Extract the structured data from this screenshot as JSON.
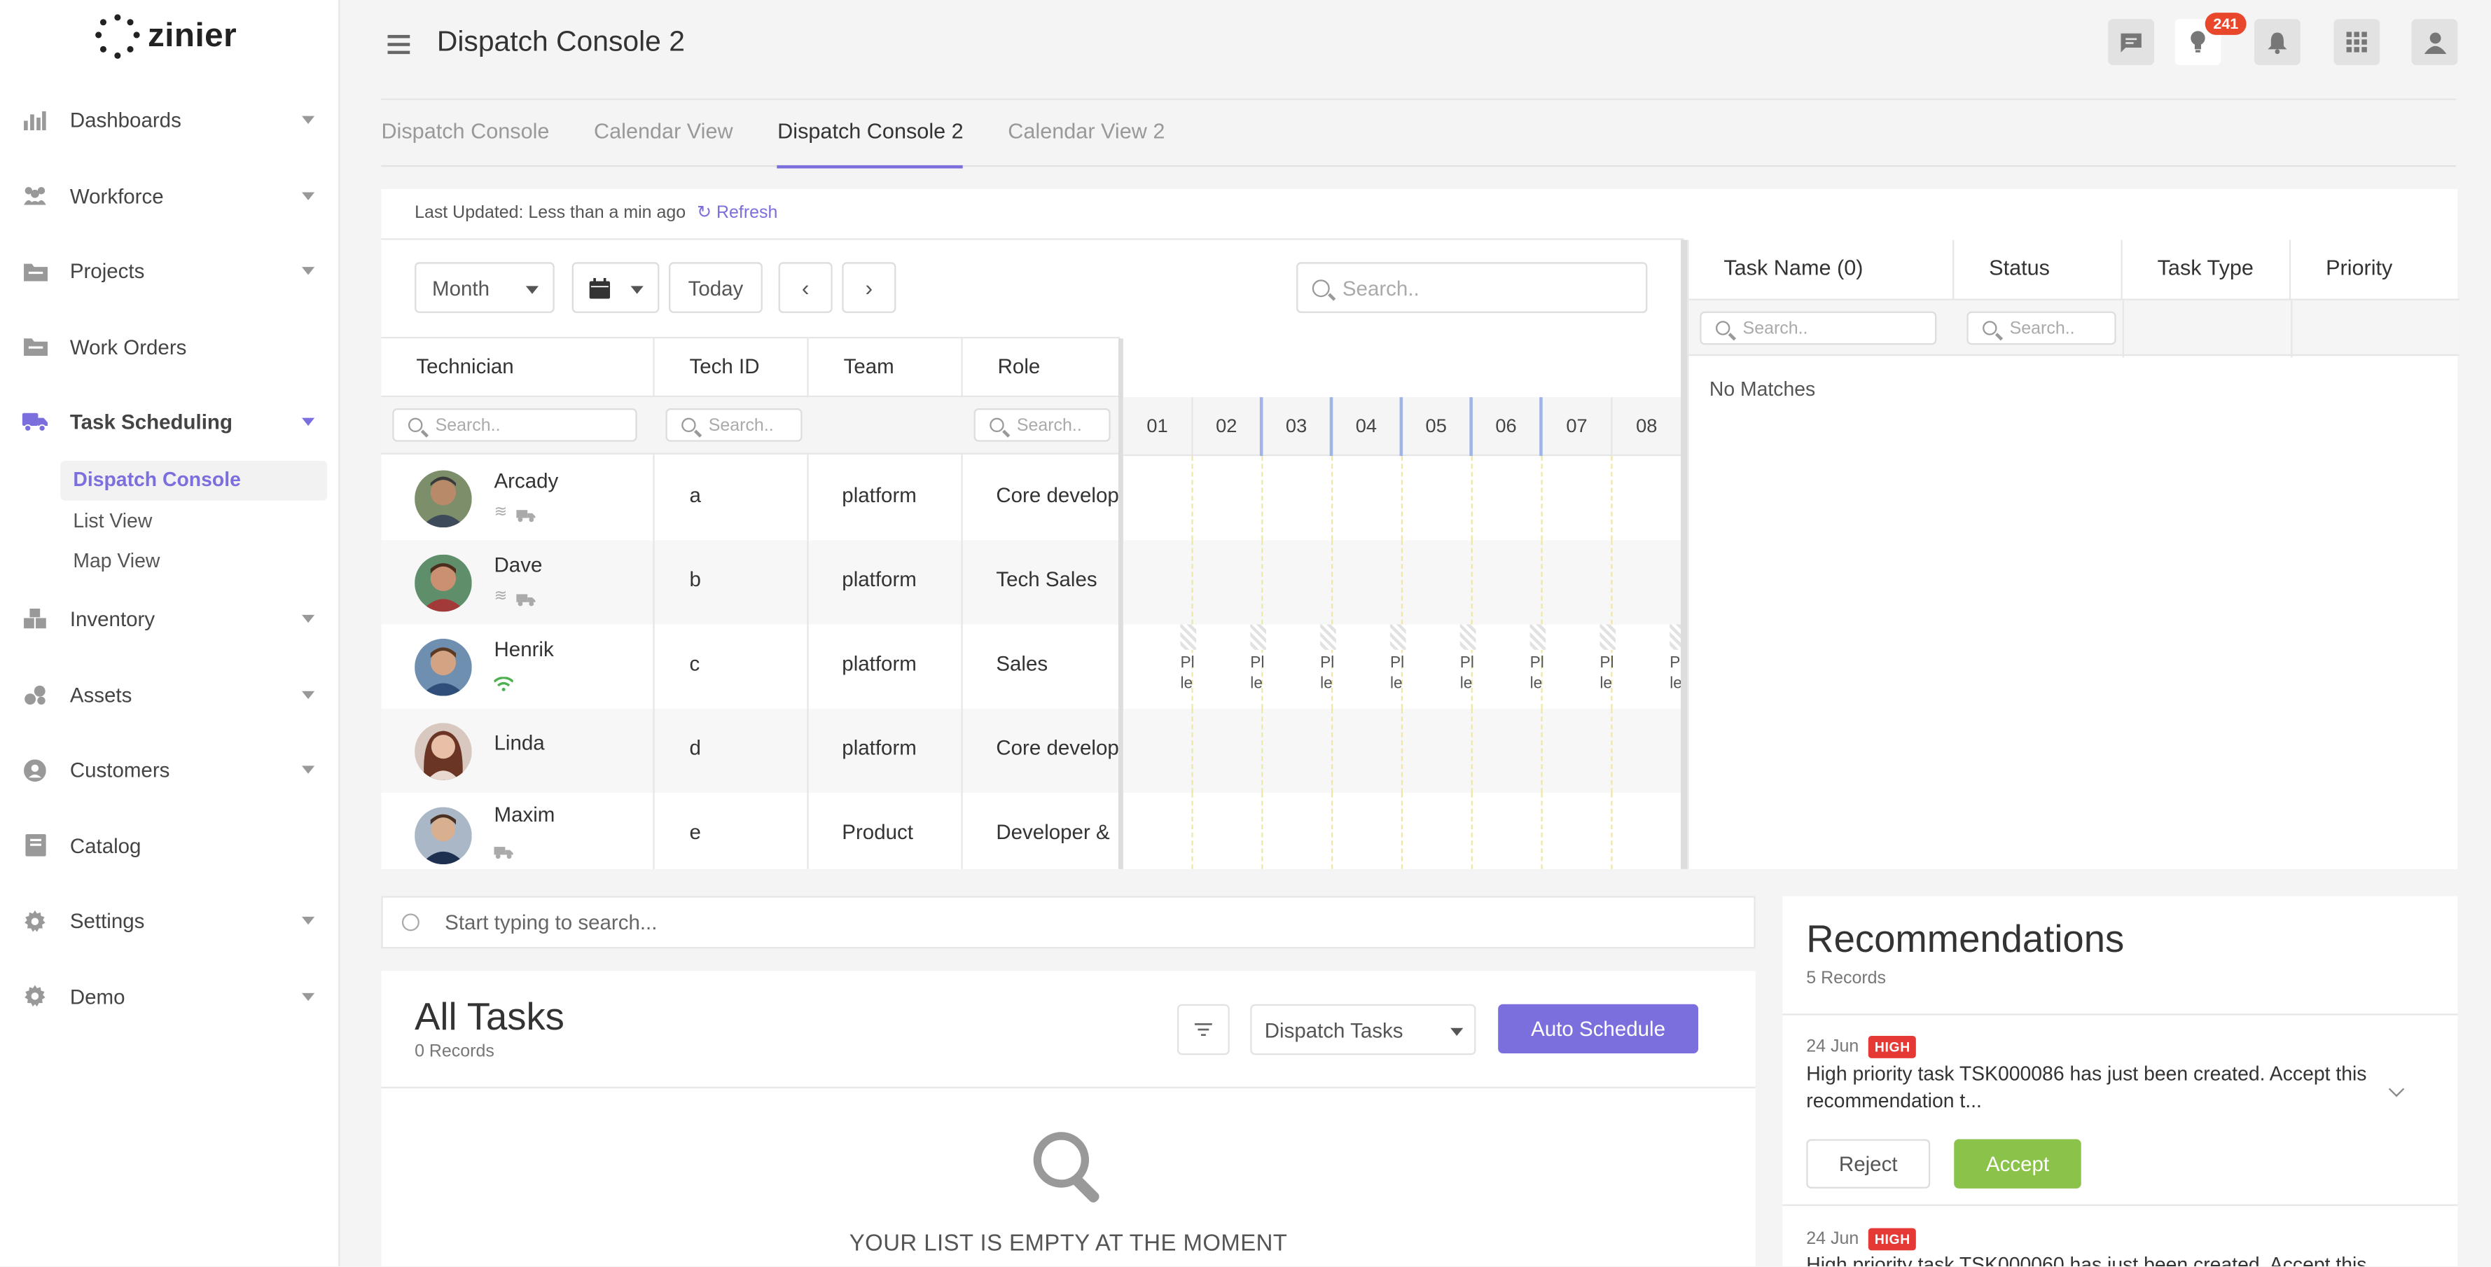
{
  "app": {
    "logo_text": "zinier",
    "page_title": "Dispatch Console 2",
    "notification_count": "241"
  },
  "sidebar": {
    "items": [
      {
        "label": "Dashboards",
        "icon": "bar-chart-icon"
      },
      {
        "label": "Workforce",
        "icon": "people-icon"
      },
      {
        "label": "Projects",
        "icon": "folder-icon"
      },
      {
        "label": "Work Orders",
        "icon": "folder-icon"
      },
      {
        "label": "Task Scheduling",
        "icon": "truck-icon"
      },
      {
        "label": "Inventory",
        "icon": "boxes-icon"
      },
      {
        "label": "Assets",
        "icon": "assets-icon"
      },
      {
        "label": "Customers",
        "icon": "user-circle-icon"
      },
      {
        "label": "Catalog",
        "icon": "book-icon"
      },
      {
        "label": "Settings",
        "icon": "gear-icon"
      },
      {
        "label": "Demo",
        "icon": "gear-icon"
      }
    ],
    "sub_items": [
      "Dispatch Console",
      "List View",
      "Map View"
    ]
  },
  "tabs": [
    "Dispatch Console",
    "Calendar View",
    "Dispatch Console 2",
    "Calendar View 2"
  ],
  "panel": {
    "last_updated": "Last Updated: Less than a min ago",
    "refresh": "Refresh",
    "view_select": "Month",
    "today": "Today",
    "search_placeholder": "Search.."
  },
  "grid": {
    "columns": [
      "Technician",
      "Tech ID",
      "Team",
      "Role"
    ],
    "filter_placeholder": "Search..",
    "days": [
      "01",
      "02",
      "03",
      "04",
      "05",
      "06",
      "07",
      "08"
    ],
    "rows": [
      {
        "name": "Arcady",
        "id": "a",
        "team": "platform",
        "role": "Core develop"
      },
      {
        "name": "Dave",
        "id": "b",
        "team": "platform",
        "role": "Tech Sales"
      },
      {
        "name": "Henrik",
        "id": "c",
        "team": "platform",
        "role": "Sales"
      },
      {
        "name": "Linda",
        "id": "d",
        "team": "platform",
        "role": "Core develop"
      },
      {
        "name": "Maxim",
        "id": "e",
        "team": "Product",
        "role": "Developer &"
      }
    ],
    "henrik_events": [
      {
        "l1": "Pl",
        "l2": "le"
      }
    ]
  },
  "task_panel": {
    "columns": [
      "Task Name (0)",
      "Status",
      "Task Type",
      "Priority"
    ],
    "filter_placeholder": "Search..",
    "no_matches": "No Matches"
  },
  "bottom": {
    "search_placeholder": "Start typing to search...",
    "all_tasks_title": "All Tasks",
    "all_tasks_count": "0 Records",
    "dispatch_select": "Dispatch Tasks",
    "auto_schedule": "Auto Schedule",
    "empty_message": "YOUR LIST IS EMPTY AT THE MOMENT"
  },
  "recommendations": {
    "title": "Recommendations",
    "count": "5 Records",
    "items": [
      {
        "date": "24 Jun",
        "priority": "HIGH",
        "text": "High priority task TSK000086 has just been created. Accept this recommendation t..."
      },
      {
        "date": "24 Jun",
        "priority": "HIGH",
        "text": "High priority task TSK000060 has just been created. Accept this"
      }
    ],
    "reject": "Reject",
    "accept": "Accept"
  },
  "colors": {
    "accent": "#7b6fde",
    "accept": "#8bc34a",
    "badge": "#e8472c",
    "high": "#e53935"
  }
}
